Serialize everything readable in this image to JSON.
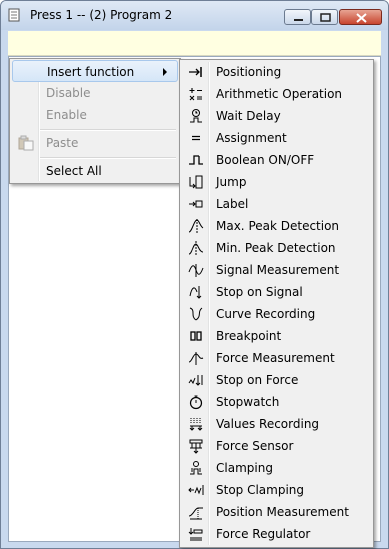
{
  "window": {
    "title": "Press 1 -- (2) Program 2",
    "icons": {
      "app": "document-icon",
      "minimize": "minimize-icon",
      "maximize": "maximize-icon",
      "close": "close-icon"
    }
  },
  "context_menu": {
    "items": [
      {
        "label": "Insert function",
        "state": "highlighted",
        "has_submenu": true
      },
      {
        "label": "Disable",
        "state": "disabled"
      },
      {
        "label": "Enable",
        "state": "disabled"
      },
      {
        "label": "Paste",
        "state": "disabled",
        "icon": "paste-icon"
      },
      {
        "label": "Select All",
        "state": "enabled"
      }
    ]
  },
  "submenu": {
    "items": [
      {
        "label": "Positioning",
        "icon": "positioning-icon"
      },
      {
        "label": "Arithmetic Operation",
        "icon": "arithmetic-icon"
      },
      {
        "label": "Wait Delay",
        "icon": "wait-delay-icon"
      },
      {
        "label": "Assignment",
        "icon": "assignment-icon"
      },
      {
        "label": "Boolean ON/OFF",
        "icon": "boolean-icon"
      },
      {
        "label": "Jump",
        "icon": "jump-icon"
      },
      {
        "label": "Label",
        "icon": "label-icon"
      },
      {
        "label": "Max. Peak Detection",
        "icon": "max-peak-icon"
      },
      {
        "label": "Min. Peak Detection",
        "icon": "min-peak-icon"
      },
      {
        "label": "Signal Measurement",
        "icon": "signal-measurement-icon"
      },
      {
        "label": "Stop on Signal",
        "icon": "stop-signal-icon"
      },
      {
        "label": "Curve Recording",
        "icon": "curve-recording-icon"
      },
      {
        "label": "Breakpoint",
        "icon": "breakpoint-icon"
      },
      {
        "label": "Force Measurement",
        "icon": "force-measurement-icon"
      },
      {
        "label": "Stop on Force",
        "icon": "stop-force-icon"
      },
      {
        "label": "Stopwatch",
        "icon": "stopwatch-icon"
      },
      {
        "label": "Values Recording",
        "icon": "values-recording-icon"
      },
      {
        "label": "Force Sensor",
        "icon": "force-sensor-icon"
      },
      {
        "label": "Clamping",
        "icon": "clamping-icon"
      },
      {
        "label": "Stop Clamping",
        "icon": "stop-clamping-icon"
      },
      {
        "label": "Position Measurement",
        "icon": "position-measurement-icon"
      },
      {
        "label": "Force Regulator",
        "icon": "force-regulator-icon"
      }
    ]
  }
}
